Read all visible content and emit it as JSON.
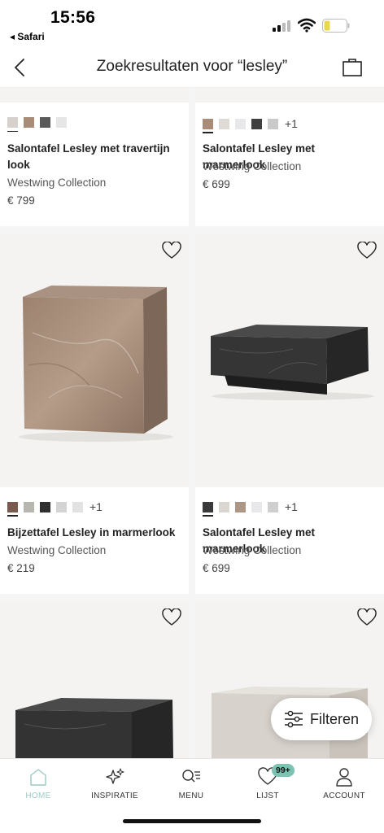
{
  "status_bar": {
    "time": "15:56",
    "back_app": "◂ Safari"
  },
  "header": {
    "title": "Zoekresultaten voor “lesley”"
  },
  "products": [
    {
      "name": "Salontafel Lesley met travertijn look",
      "brand": "Westwing Collection",
      "price": "€ 799",
      "swatches": [
        "#d6d1cc",
        "#a88c78",
        "#5a5a5a",
        "#e6e6e6"
      ],
      "more": ""
    },
    {
      "name": "Salontafel Lesley met marmerlook",
      "brand": "Westwing Collection",
      "price": "€ 699",
      "swatches": [
        "#a88c78",
        "#dedad6",
        "#e8e8ea",
        "#3f3f3f",
        "#c9c9c9"
      ],
      "more": "+1"
    },
    {
      "name": "Bijzettafel Lesley in marmerlook",
      "brand": "Westwing Collection",
      "price": "€ 219",
      "swatches": [
        "#7a5a4c",
        "#b8b6b0",
        "#2f2f2f",
        "#d4d4d4",
        "#e2e2e2"
      ],
      "more": "+1"
    },
    {
      "name": "Salontafel Lesley met marmerlook",
      "brand": "Westwing Collection",
      "price": "€ 699",
      "swatches": [
        "#3a3a3a",
        "#dad7d2",
        "#ad9684",
        "#e8e8ea",
        "#cfcfcf"
      ],
      "more": "+1"
    }
  ],
  "filter_button": {
    "label": "Filteren"
  },
  "tabs": [
    {
      "label": "HOME",
      "icon": "home-icon"
    },
    {
      "label": "INSPIRATIE",
      "icon": "sparkle-icon"
    },
    {
      "label": "MENU",
      "icon": "menu-search-icon"
    },
    {
      "label": "LIJST",
      "icon": "heart-icon",
      "badge": "99+"
    },
    {
      "label": "ACCOUNT",
      "icon": "user-icon"
    }
  ],
  "colors": {
    "accent": "#7cc3b4",
    "active_tab": "#9ec9c2",
    "background": "#f5f5f5"
  }
}
